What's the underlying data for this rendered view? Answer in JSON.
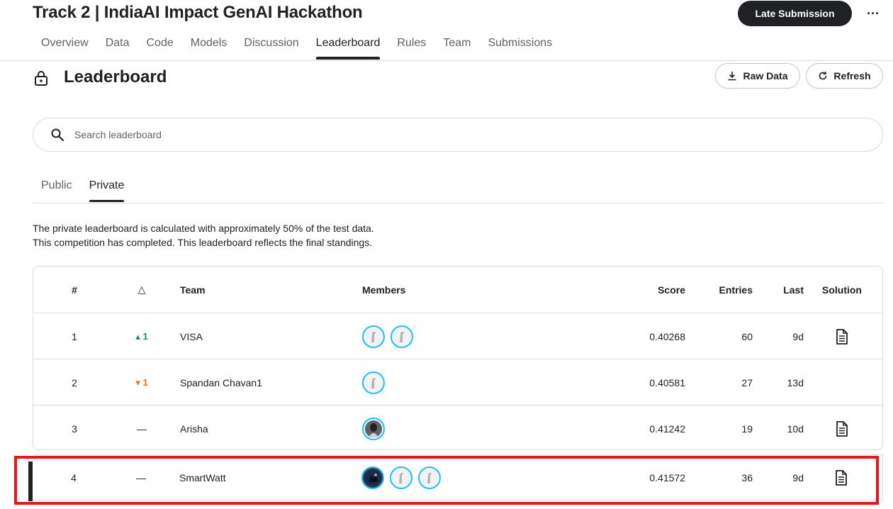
{
  "header": {
    "title": "Track 2 | IndiaAI Impact GenAI Hackathon",
    "late_submission_label": "Late Submission",
    "more_label": "···"
  },
  "nav": {
    "tabs": [
      {
        "label": "Overview"
      },
      {
        "label": "Data"
      },
      {
        "label": "Code"
      },
      {
        "label": "Models"
      },
      {
        "label": "Discussion"
      },
      {
        "label": "Leaderboard",
        "active": true
      },
      {
        "label": "Rules"
      },
      {
        "label": "Team"
      },
      {
        "label": "Submissions"
      }
    ]
  },
  "leaderboard": {
    "heading": "Leaderboard",
    "raw_data_label": "Raw Data",
    "refresh_label": "Refresh",
    "search_placeholder": "Search leaderboard",
    "tabs": [
      {
        "label": "Public"
      },
      {
        "label": "Private",
        "active": true
      }
    ],
    "info_line1": "The private leaderboard is calculated with approximately 50% of the test data.",
    "info_line2": "This competition has completed. This leaderboard reflects the final standings.",
    "columns": {
      "rank": "#",
      "delta": "△",
      "team": "Team",
      "members": "Members",
      "score": "Score",
      "entries": "Entries",
      "last": "Last",
      "solution": "Solution"
    },
    "rows": [
      {
        "rank": "1",
        "delta": "▴ 1",
        "delta_dir": "up",
        "team": "VISA",
        "members": 2,
        "score": "0.40268",
        "entries": "60",
        "last": "9d",
        "solution": true
      },
      {
        "rank": "2",
        "delta": "▾ 1",
        "delta_dir": "down",
        "team": "Spandan Chavan1",
        "members": 1,
        "score": "0.40581",
        "entries": "27",
        "last": "13d",
        "solution": false
      },
      {
        "rank": "3",
        "delta": "—",
        "delta_dir": "none",
        "team": "Arisha",
        "members": 1,
        "score": "0.41242",
        "entries": "19",
        "last": "10d",
        "solution": true
      },
      {
        "rank": "4",
        "delta": "—",
        "delta_dir": "none",
        "team": "SmartWatt",
        "members": 3,
        "score": "0.41572",
        "entries": "36",
        "last": "9d",
        "solution": true
      }
    ]
  },
  "colors": {
    "accent": "#20beff",
    "up": "#1e8e3e",
    "down": "#e8710a",
    "highlight": "#e3181e"
  }
}
